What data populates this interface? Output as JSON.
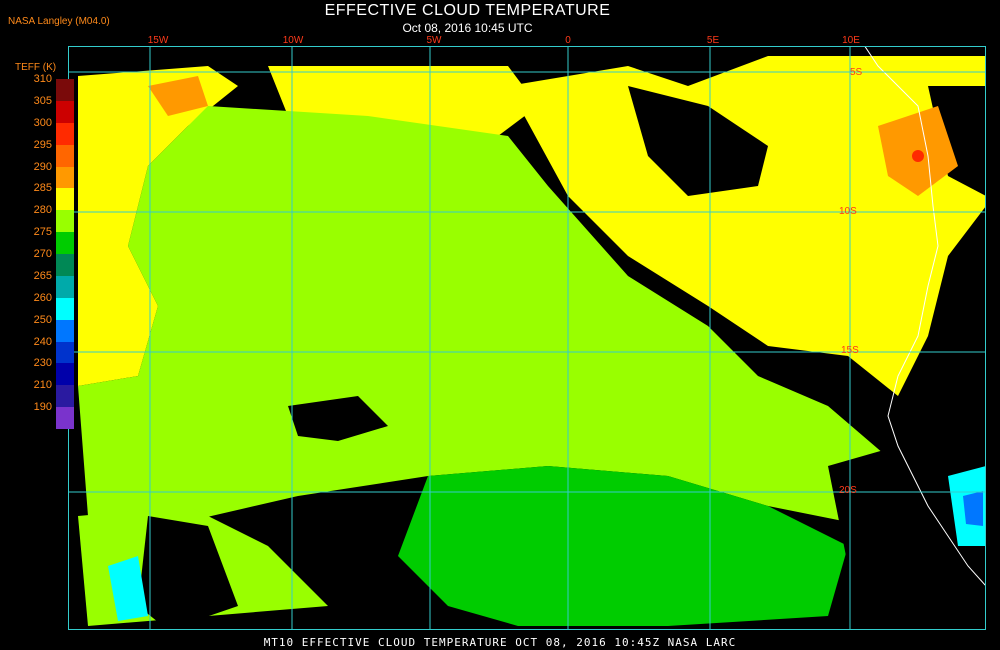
{
  "header": {
    "brand": "NASA Langley (M04.0)",
    "title": "EFFECTIVE CLOUD TEMPERATURE",
    "subtitle": "Oct 08, 2016 10:45 UTC"
  },
  "footer": {
    "caption": "MT10  EFFECTIVE CLOUD TEMPERATURE  OCT 08, 2016 10:45Z  NASA LARC"
  },
  "legend": {
    "title": "TEFF (K)",
    "ticks": [
      "310",
      "305",
      "300",
      "295",
      "290",
      "285",
      "280",
      "275",
      "270",
      "265",
      "260",
      "250",
      "240",
      "230",
      "210",
      "190"
    ],
    "colors": [
      "#7a0a0a",
      "#cc0000",
      "#ff2a00",
      "#ff6600",
      "#ff9900",
      "#ffff00",
      "#99ff00",
      "#00cc00",
      "#008855",
      "#00aaaa",
      "#00ffff",
      "#0077ff",
      "#0033cc",
      "#0000aa",
      "#2a1aa0",
      "#7a33cc"
    ]
  },
  "grid": {
    "lon_labels": [
      "15W",
      "10W",
      "5W",
      "0",
      "5E",
      "10E"
    ],
    "lat_labels": [
      "5S",
      "10S",
      "15S",
      "20S"
    ],
    "line_color": "#33cccc"
  },
  "colors": {
    "cloud_yellow": "#ffff00",
    "cloud_lime": "#99ff00",
    "cloud_green": "#00cc00",
    "clear_black": "#000000",
    "coast": "#ffffff",
    "label_red": "#ff3a1a",
    "label_orange": "#ff8a1a"
  }
}
